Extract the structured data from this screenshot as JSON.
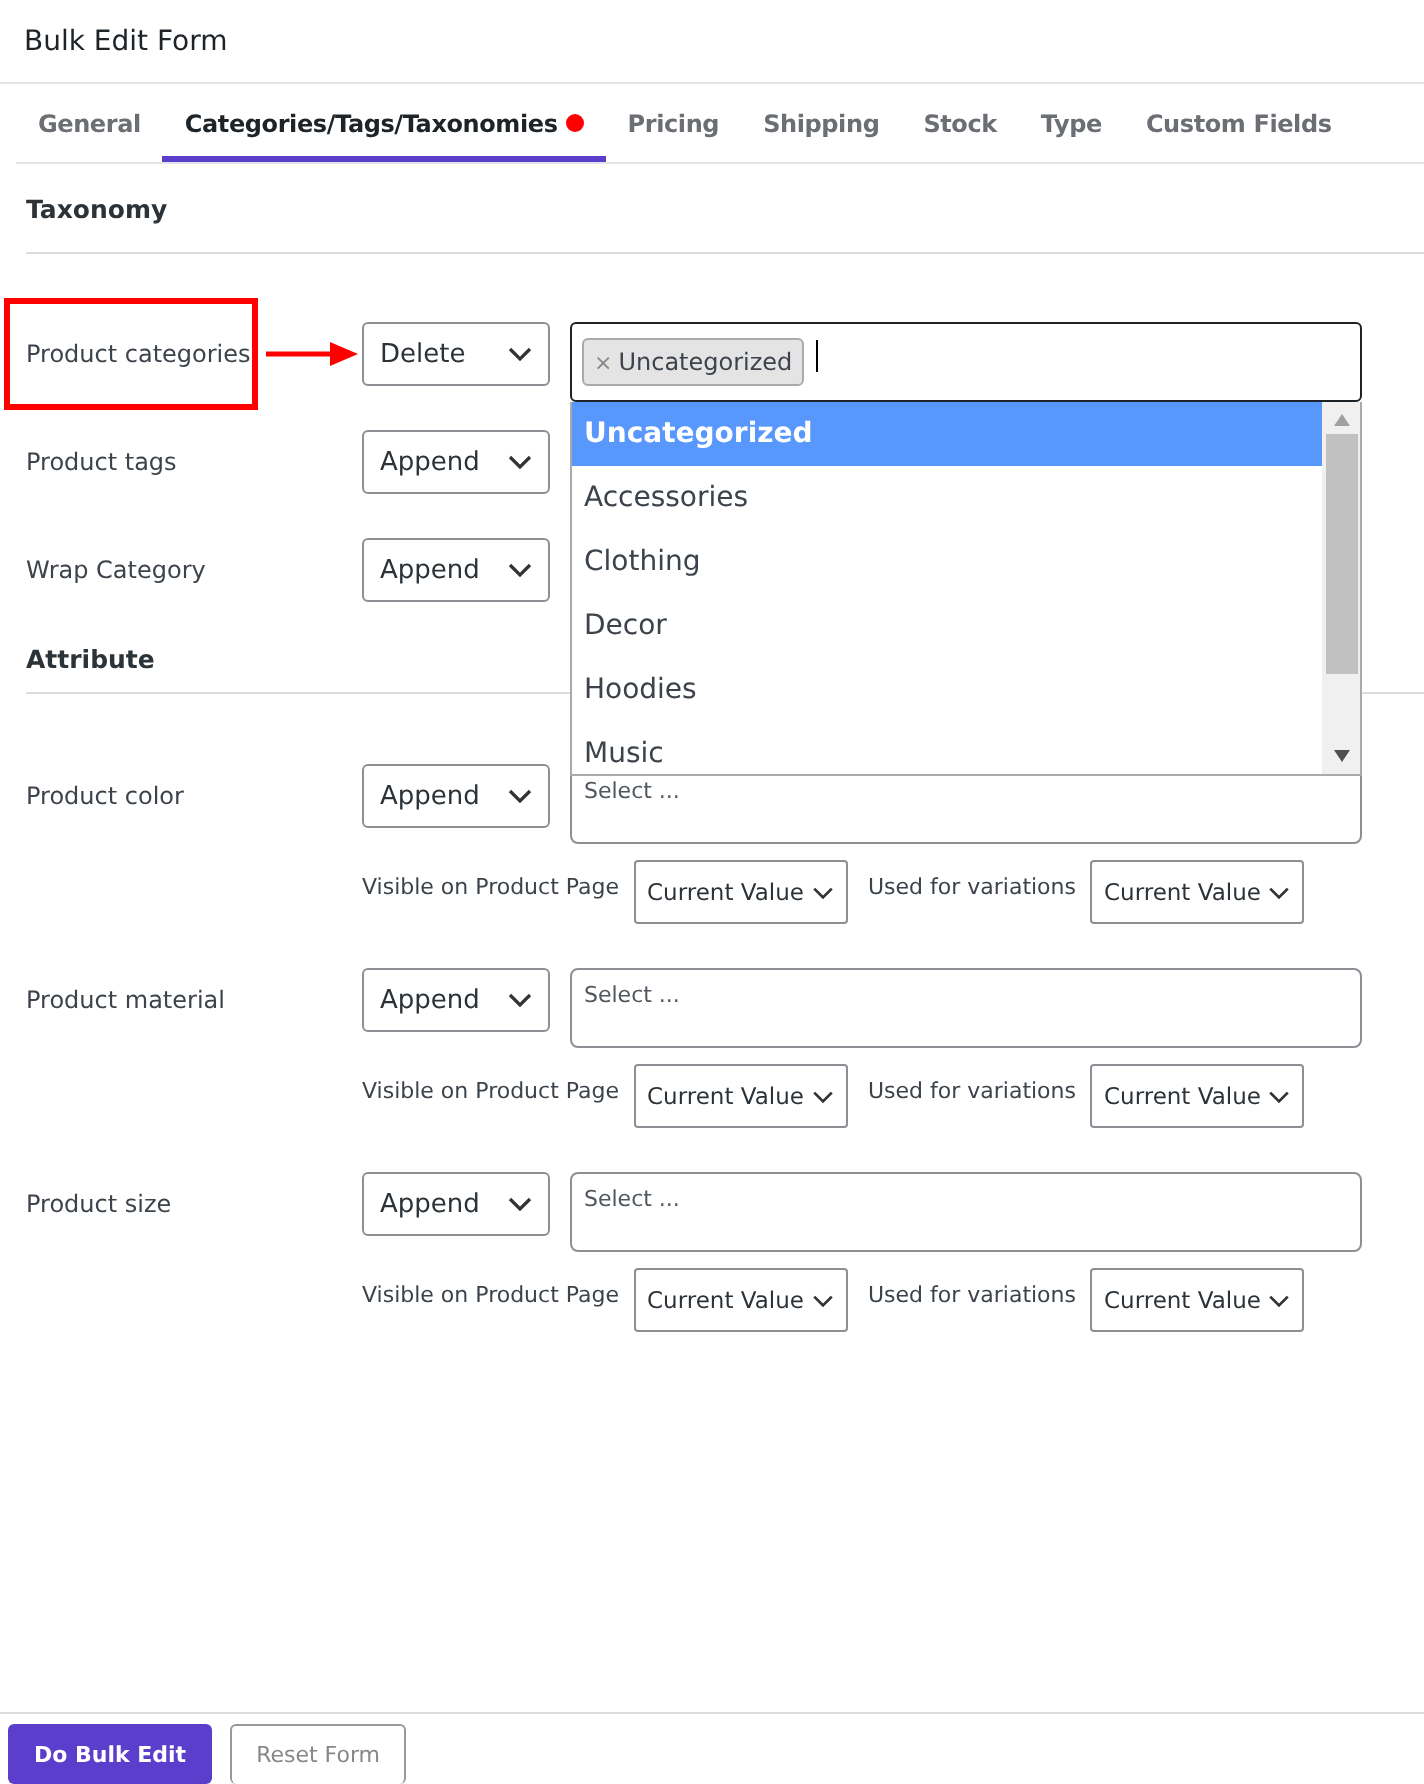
{
  "title": "Bulk Edit Form",
  "tabs": [
    {
      "label": "General",
      "selected": false,
      "dot": false
    },
    {
      "label": "Categories/Tags/Taxonomies",
      "selected": true,
      "dot": true
    },
    {
      "label": "Pricing",
      "selected": false,
      "dot": false
    },
    {
      "label": "Shipping",
      "selected": false,
      "dot": false
    },
    {
      "label": "Stock",
      "selected": false,
      "dot": false
    },
    {
      "label": "Type",
      "selected": false,
      "dot": false
    },
    {
      "label": "Custom Fields",
      "selected": false,
      "dot": false
    }
  ],
  "taxonomy": {
    "heading": "Taxonomy",
    "rows": [
      {
        "label": "Product categories",
        "highlight": true,
        "action": "Delete",
        "field": {
          "tokens": [
            {
              "remove": "×",
              "label": "Uncategorized"
            }
          ],
          "dropdown": [
            {
              "label": "Uncategorized",
              "selected": true
            },
            {
              "label": "Accessories",
              "selected": false
            },
            {
              "label": "Clothing",
              "selected": false
            },
            {
              "label": "Decor",
              "selected": false
            },
            {
              "label": "Hoodies",
              "selected": false
            },
            {
              "label": "Music",
              "selected": false
            }
          ]
        }
      },
      {
        "label": "Product tags",
        "highlight": false,
        "action": "Append"
      },
      {
        "label": "Wrap Category",
        "highlight": false,
        "action": "Append"
      }
    ]
  },
  "attribute": {
    "heading": "Attribute",
    "rows": [
      {
        "label": "Product color",
        "action": "Append",
        "placeholder": "Select ...",
        "visible_label": "Visible on Product Page",
        "visible_value": "Current Value",
        "variations_label": "Used for variations",
        "variations_value": "Current Value"
      },
      {
        "label": "Product material",
        "action": "Append",
        "placeholder": "Select ...",
        "visible_label": "Visible on Product Page",
        "visible_value": "Current Value",
        "variations_label": "Used for variations",
        "variations_value": "Current Value"
      },
      {
        "label": "Product size",
        "action": "Append",
        "placeholder": "Select ...",
        "visible_label": "Visible on Product Page",
        "visible_value": "Current Value",
        "variations_label": "Used for variations",
        "variations_value": "Current Value"
      }
    ]
  },
  "footer": {
    "primary": "Do Bulk Edit",
    "secondary": "Reset Form"
  }
}
